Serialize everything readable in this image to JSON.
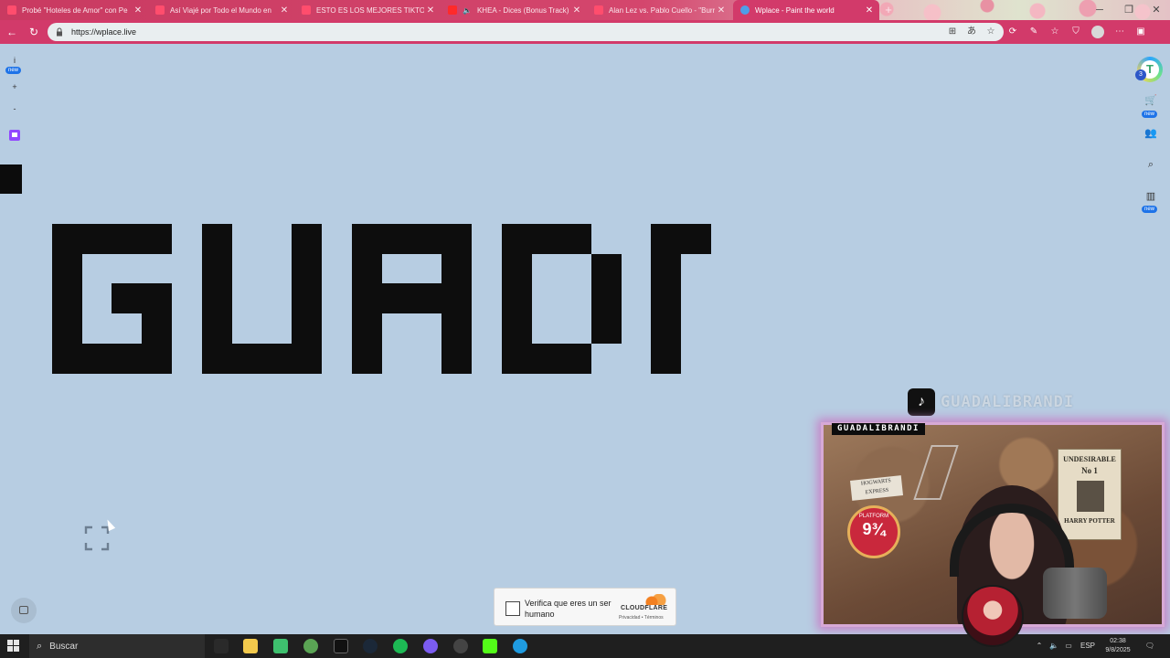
{
  "browser": {
    "tabs": [
      {
        "label": "Probé \"Hoteles de Amor\" con Pe",
        "favicon": "youtube-icon",
        "active": false
      },
      {
        "label": "Así Viajé por Todo el Mundo en",
        "favicon": "youtube-icon",
        "active": false
      },
      {
        "label": "ESTO ES LOS MEJORES TIKTOKS",
        "favicon": "youtube-icon",
        "active": false
      },
      {
        "label": "KHEA - Dices (Bonus Track)",
        "favicon": "youtube-icon",
        "active": false
      },
      {
        "label": "Alan Lez vs. Pablo Cuello - \"Burro",
        "favicon": "youtube-icon",
        "active": false
      },
      {
        "label": "Wplace - Paint the world",
        "favicon": "globe-icon",
        "active": true
      }
    ],
    "address": "https://wplace.live",
    "accent_color": "#d23a6a"
  },
  "wplace": {
    "left_toolbar": {
      "info": "i",
      "new_badge": "new",
      "zoom_in": "+",
      "zoom_out": "-"
    },
    "right_toolbar": {
      "profile_badge_number": "3",
      "store_new_badge": "new",
      "leaderboard_new_badge": "new"
    },
    "canvas_color": "#b7cde2",
    "pixel_color": "#0d0d0d"
  },
  "captcha": {
    "text": "Verifica que eres un ser humano",
    "brand": "CLOUDFLARE",
    "links": "Privacidad  •  Términos"
  },
  "stream_overlay": {
    "tiktok_handle": "GUADALIBRANDI",
    "cam_label": "GUADALIBRANDI",
    "poster_title": "UNDESIRABLE",
    "poster_number": "No 1",
    "poster_name": "HARRY POTTER",
    "sticker_text": "HOGWARTS EXPRESS",
    "platform_label": "PLATFORM",
    "platform_number": "9¾"
  },
  "taskbar": {
    "search_placeholder": "Buscar",
    "language": "ESP",
    "time": "02:38",
    "date": "9/8/2025"
  }
}
